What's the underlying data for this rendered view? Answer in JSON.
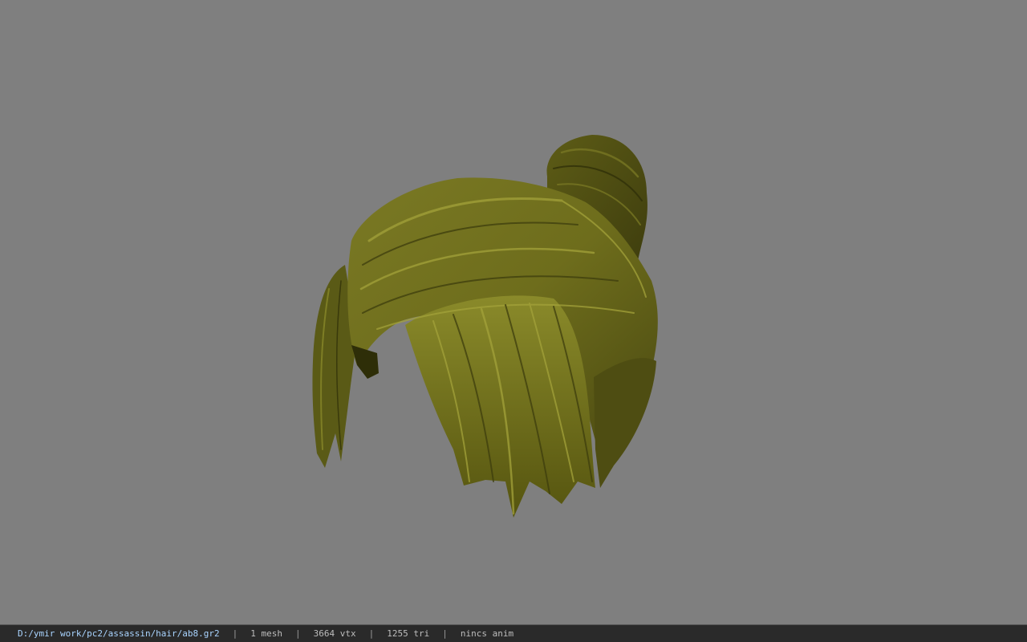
{
  "viewer": {
    "background_color": "#7f7f7f",
    "model": {
      "name": "ab8.gr2",
      "base_color": "#6e6d1c",
      "highlight_color": "#a3a23a",
      "shadow_color": "#3d3d0d"
    }
  },
  "status_bar": {
    "file_path": "D:/ymir work/pc2/assassin/hair/ab8.gr2",
    "separator": "|",
    "mesh_count": "1 mesh",
    "vertex_count": "3664 vtx",
    "triangle_count": "1255 tri",
    "anim_status": "nincs anim"
  }
}
